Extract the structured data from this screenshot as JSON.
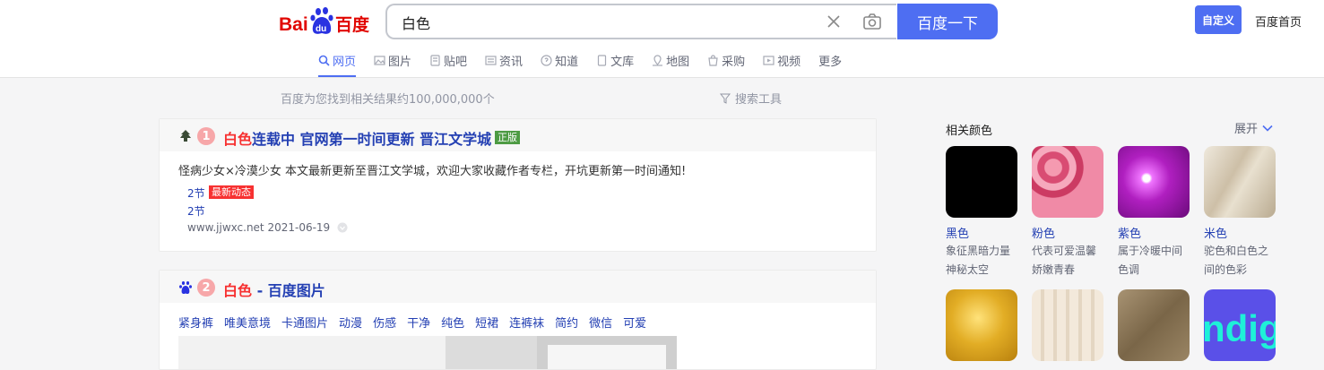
{
  "logo": {
    "text_left": "Bai",
    "text_paw": "du",
    "text_right": "百度"
  },
  "search": {
    "value": "白色",
    "button_label": "百度一下"
  },
  "header": {
    "custom_label": "自定义",
    "home_label": "百度首页"
  },
  "tabs": [
    {
      "label": "网页",
      "icon": "search-icon",
      "active": true
    },
    {
      "label": "图片",
      "icon": "image-icon"
    },
    {
      "label": "贴吧",
      "icon": "tieba-icon"
    },
    {
      "label": "资讯",
      "icon": "news-icon"
    },
    {
      "label": "知道",
      "icon": "question-icon"
    },
    {
      "label": "文库",
      "icon": "doc-icon"
    },
    {
      "label": "地图",
      "icon": "map-icon"
    },
    {
      "label": "采购",
      "icon": "shop-icon"
    },
    {
      "label": "视频",
      "icon": "video-icon"
    },
    {
      "label": "更多"
    }
  ],
  "results_meta": {
    "count_text": "百度为您找到相关结果约100,000,000个",
    "tools_label": "搜索工具"
  },
  "result1": {
    "number": "1",
    "title_hl": "白色",
    "title_rest": "连载中 官网第一时间更新 晋江文学城",
    "badge": "正版",
    "desc": "怪病少女×冷漠少女 本文最新更新至晋江文学城，欢迎大家收藏作者专栏，开坑更新第一时间通知!",
    "link1": "2节",
    "link1_badge": "最新动态",
    "link2": "2节",
    "url": "www.jjwxc.net 2021-06-19"
  },
  "result2": {
    "number": "2",
    "title_hl": "白色",
    "title_rest": " - 百度图片",
    "tags": [
      "紧身裤",
      "唯美意境",
      "卡通图片",
      "动漫",
      "伤感",
      "干净",
      "纯色",
      "短裙",
      "连裤袜",
      "简约",
      "微信",
      "可爱"
    ]
  },
  "sidebar": {
    "title": "相关颜色",
    "expand_label": "展开",
    "colors": [
      {
        "name": "黑色",
        "desc": "象征黑暗力量神秘太空",
        "color": "#000000"
      },
      {
        "name": "粉色",
        "desc": "代表可爱温馨娇嫩青春",
        "color": "#e7557a"
      },
      {
        "name": "紫色",
        "desc": "属于冷暖中间色调",
        "color": "#b01fc0"
      },
      {
        "name": "米色",
        "desc": "驼色和白色之间的色彩",
        "color": "#d8cfbc"
      },
      {
        "name": "",
        "desc": "",
        "color": "#d9a21e"
      },
      {
        "name": "",
        "desc": "",
        "color": "#ece1d1"
      },
      {
        "name": "",
        "desc": "",
        "color": "#8d7a5b"
      },
      {
        "name": "",
        "desc": "",
        "color": "#5a50e8"
      }
    ]
  }
}
